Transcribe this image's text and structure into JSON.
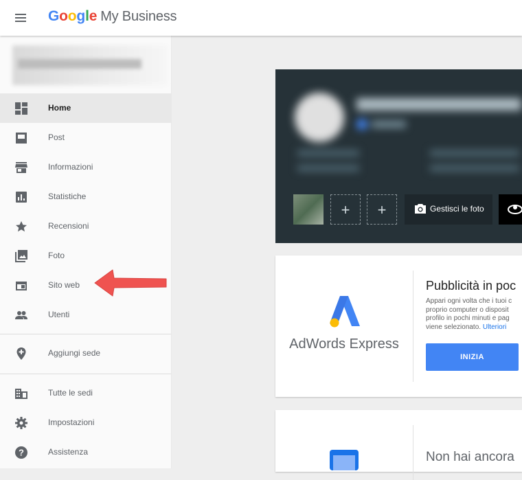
{
  "header": {
    "brand_google": "Google",
    "brand_rest": "My Business"
  },
  "sidebar": {
    "items": [
      {
        "label": "Home",
        "icon": "dashboard-icon"
      },
      {
        "label": "Post",
        "icon": "post-icon"
      },
      {
        "label": "Informazioni",
        "icon": "store-icon"
      },
      {
        "label": "Statistiche",
        "icon": "insights-icon"
      },
      {
        "label": "Recensioni",
        "icon": "star-icon"
      },
      {
        "label": "Foto",
        "icon": "photo-library-icon"
      },
      {
        "label": "Sito web",
        "icon": "web-icon"
      },
      {
        "label": "Utenti",
        "icon": "people-icon"
      },
      {
        "label": "Aggiungi sede",
        "icon": "add-location-icon"
      },
      {
        "label": "Tutte le sedi",
        "icon": "business-icon"
      },
      {
        "label": "Impostazioni",
        "icon": "gear-icon"
      },
      {
        "label": "Assistenza",
        "icon": "help-icon"
      }
    ],
    "active": "Home"
  },
  "cover": {
    "add_symbol": "+",
    "manage_photos_label": "Gestisci le foto"
  },
  "adwords_card": {
    "product_name": "AdWords Express",
    "title": "Pubblicità in poc",
    "text_lines": [
      "Appari ogni volta che i tuoi c",
      "proprio computer o disposit",
      "profilo in pochi minuti e pag",
      "viene selezionato."
    ],
    "link_label": "Ulteriori",
    "cta_label": "INIZIA"
  },
  "second_card": {
    "title": "Non hai ancora"
  },
  "colors": {
    "accent": "#4285f4",
    "arrow": "#ef5350",
    "cover_bg": "#263238"
  }
}
